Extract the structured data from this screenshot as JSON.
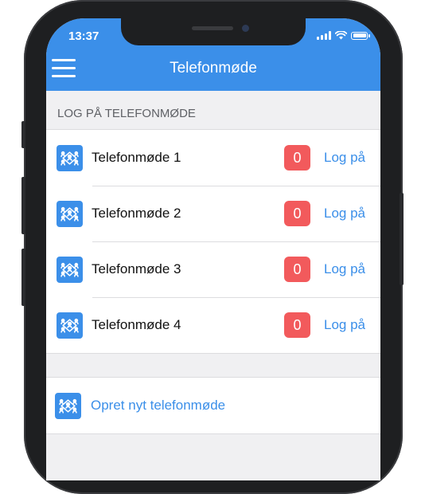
{
  "status_bar": {
    "time": "13:37"
  },
  "nav": {
    "title": "Telefonmøde",
    "menu_icon": "hamburger-menu-icon"
  },
  "section": {
    "title": "LOG PÅ TELEFONMØDE"
  },
  "meetings": [
    {
      "name": "Telefonmøde 1",
      "count": "0",
      "action": "Log på"
    },
    {
      "name": "Telefonmøde 2",
      "count": "0",
      "action": "Log på"
    },
    {
      "name": "Telefonmøde 3",
      "count": "0",
      "action": "Log på"
    },
    {
      "name": "Telefonmøde 4",
      "count": "0",
      "action": "Log på"
    }
  ],
  "create": {
    "label": "Opret nyt telefonmøde"
  },
  "colors": {
    "accent": "#3b8fe9",
    "badge": "#f25a5c",
    "background": "#f0f0f2"
  }
}
